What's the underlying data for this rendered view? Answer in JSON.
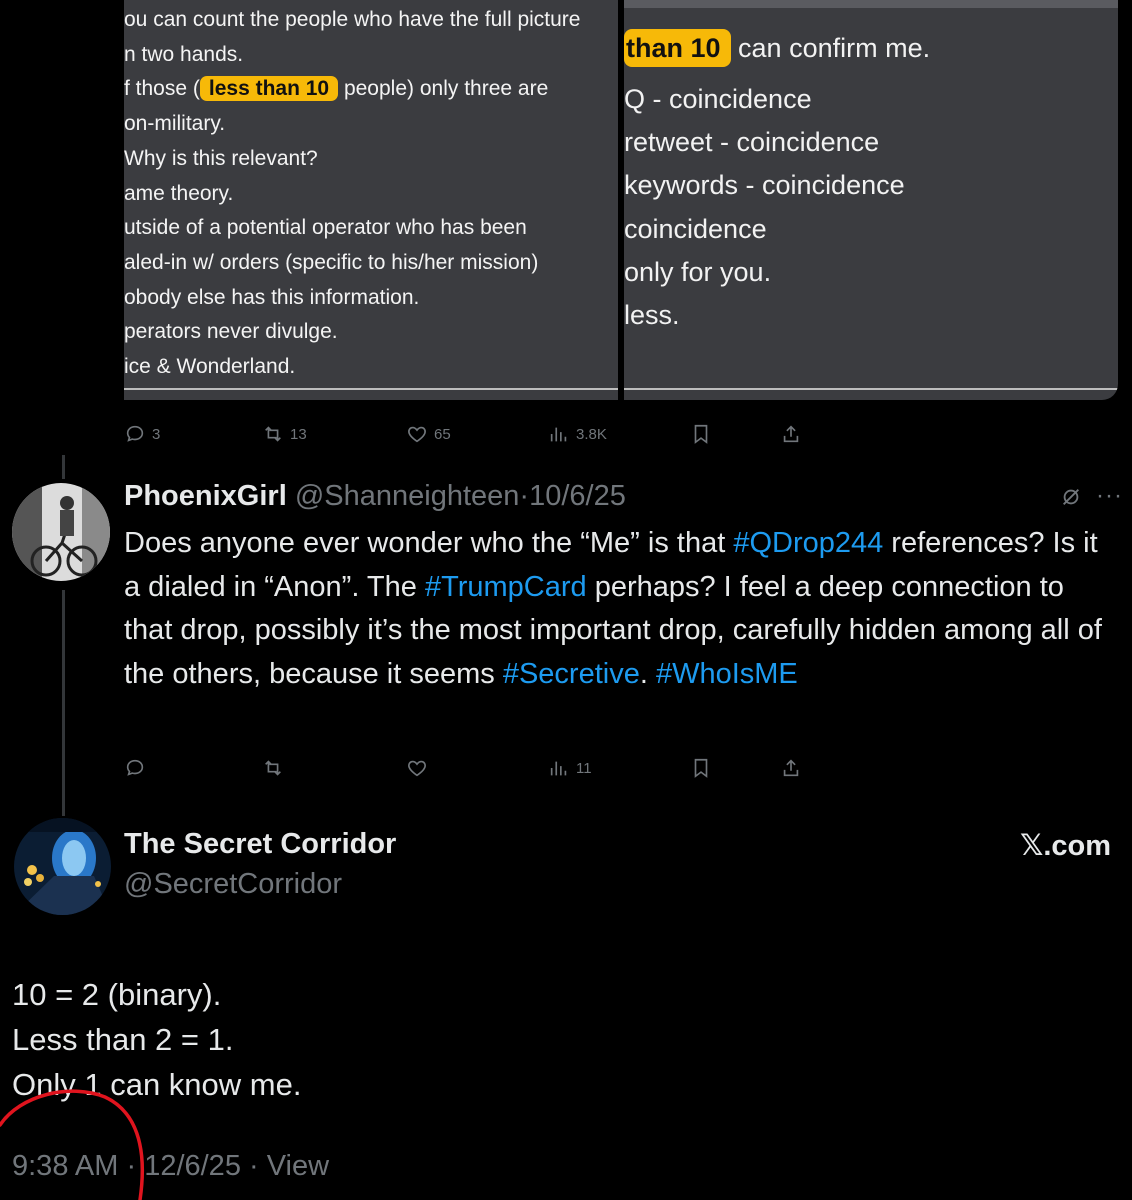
{
  "panel_left": {
    "lines": [
      {
        "text": "ou can count the people who have the full picture"
      },
      {
        "text": "n two hands."
      },
      {
        "pre": "f those (",
        "highlight": "less than 10",
        "post": " people) only three are"
      },
      {
        "text": "on-military."
      },
      {
        "text": "Why is this relevant?"
      },
      {
        "text": "ame theory."
      },
      {
        "text": "utside of a potential operator who has been"
      },
      {
        "text": "aled-in w/ orders (specific to his/her mission)"
      },
      {
        "text": "obody else has this information."
      },
      {
        "text": "perators never divulge."
      },
      {
        "text": "ice & Wonderland."
      }
    ]
  },
  "panel_right": {
    "highlight": "than 10",
    "line1_post": " can confirm me.",
    "lines": [
      "Q - coincidence",
      "retweet - coincidence",
      "keywords - coincidence",
      "coincidence",
      "only for you.",
      "less."
    ]
  },
  "first_actions": {
    "replies": "3",
    "reposts": "13",
    "likes": "65",
    "views": "3.8K"
  },
  "reply_tweet": {
    "name": "PhoenixGirl",
    "handle": "@Shanneighteen",
    "sep": "·",
    "date": "10/6/25",
    "more": "···",
    "text": [
      {
        "t": "Does anyone ever wonder who the “Me” is that "
      },
      {
        "t": "#QDrop244",
        "tag": true
      },
      {
        "t": " references? Is it a dialed in “Anon”. The "
      },
      {
        "t": "#TrumpCard",
        "tag": true
      },
      {
        "t": " perhaps? I feel a deep connection to that drop, possibly it’s the most important drop, carefully hidden among all of the others, because it seems "
      },
      {
        "t": "#Secretive",
        "tag": true
      },
      {
        "t": ". "
      },
      {
        "t": "#WhoIsME",
        "tag": true
      }
    ],
    "views": "11"
  },
  "main_tweet": {
    "name": "The Secret Corridor",
    "handle": "@SecretCorridor",
    "brand": "𝕏.com",
    "lines": [
      "10 = 2 (binary).",
      "Less than 2 = 1.",
      "Only 1 can know me."
    ],
    "time": "9:38 AM",
    "sep1": " · ",
    "date": "12/6/25",
    "sep2": " · ",
    "view_label": "View"
  },
  "colors": {
    "accent": "#1d9bf0",
    "highlight": "#f7b908",
    "annotation": "#e0141e",
    "muted": "#71767b"
  }
}
